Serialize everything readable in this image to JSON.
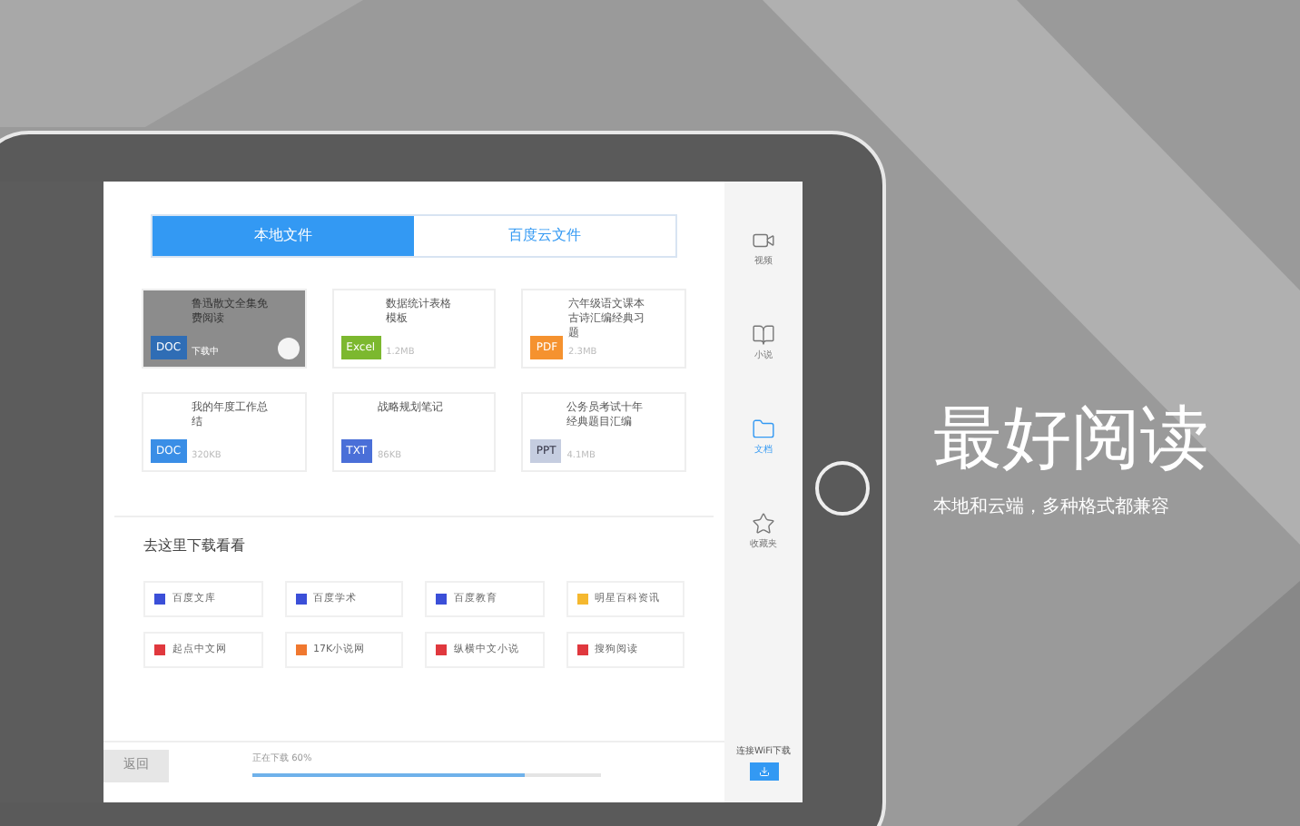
{
  "tabs": [
    {
      "label": "本地文件",
      "selected": true
    },
    {
      "label": "百度云文件",
      "selected": false
    }
  ],
  "files": [
    {
      "name": "鲁迅散文全集免费阅读",
      "badge": "DOC",
      "color": "#2f6db5",
      "meta": "下载中",
      "selected": true
    },
    {
      "name": "数据统计表格模板",
      "badge": "Excel",
      "color": "#7cb82f",
      "meta": "1.2MB",
      "selected": false
    },
    {
      "name": "六年级语文课本古诗汇编经典习题",
      "badge": "PDF",
      "color": "#f5922f",
      "meta": "2.3MB",
      "selected": false
    },
    {
      "name": "我的年度工作总结",
      "badge": "DOC",
      "color": "#3a8ee6",
      "meta": "320KB",
      "selected": false
    },
    {
      "name": "战略规划笔记",
      "badge": "TXT",
      "color": "#4a6fd8",
      "meta": "86KB",
      "selected": false
    },
    {
      "name": "公务员考试十年经典题目汇编",
      "badge": "PPT",
      "color": "#c5cde0",
      "meta": "4.1MB",
      "selected": false
    }
  ],
  "download_heading": "去这里下载看看",
  "sites": [
    {
      "name": "百度文库",
      "color": "#3b4fd8"
    },
    {
      "name": "百度学术",
      "color": "#3b4fd8"
    },
    {
      "name": "百度教育",
      "color": "#3b4fd8"
    },
    {
      "name": "明星百科资讯",
      "color": "#f5b82f"
    },
    {
      "name": "起点中文网",
      "color": "#e0383e"
    },
    {
      "name": "17K小说网",
      "color": "#f0782f"
    },
    {
      "name": "纵横中文小说",
      "color": "#e0383e"
    },
    {
      "name": "搜狗阅读",
      "color": "#e0383e"
    }
  ],
  "sidebar": [
    {
      "kind": "video",
      "label": "视频",
      "selected": false
    },
    {
      "kind": "book",
      "label": "小说",
      "selected": false
    },
    {
      "kind": "folder",
      "label": "文档",
      "selected": true
    },
    {
      "kind": "star",
      "label": "收藏夹",
      "selected": false
    }
  ],
  "footer": {
    "back": "返回",
    "progress_text": "正在下载 60%",
    "level": 0.78,
    "wifi": "连接WiFi下载"
  },
  "headline": "最好阅读",
  "subtitle": "本地和云端，多种格式都兼容"
}
